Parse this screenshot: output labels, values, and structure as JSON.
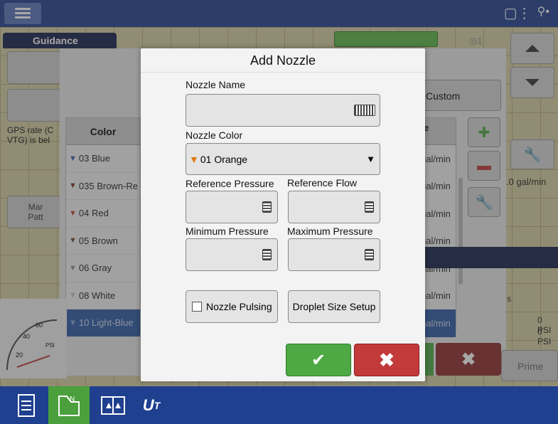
{
  "app": {
    "guidance_tab": "Guidance"
  },
  "back_panel": {
    "left_text": "GPS rate (C\nVTG) is bel",
    "left_btn_text": "Mar\nPatt",
    "gps_indicator": "◎1",
    "custom_button": "Custom",
    "color_header": "Color",
    "rate_header": "e",
    "colors": [
      {
        "label": "03 Blue",
        "color": "#2a5ea8"
      },
      {
        "label": "035 Brown-Re",
        "color": "#7a2a22"
      },
      {
        "label": "04 Red",
        "color": "#b8432a"
      },
      {
        "label": "05 Brown",
        "color": "#6d4a2e"
      },
      {
        "label": "06 Gray",
        "color": "#8a8a8a"
      },
      {
        "label": "08 White",
        "color": "#bdbdbd"
      },
      {
        "label": "10 Light-Blue",
        "color": "#8fa9d8"
      }
    ],
    "rates": [
      "gal/min",
      "gal/min",
      "gal/min",
      "gal/min",
      "gal/min",
      "gal/min",
      "gal/min"
    ],
    "side_text": ".0 gal/min",
    "psi_1": "0 PSI",
    "psi_2": "0 PSI",
    "prime": "Prime",
    "gauge_labels": [
      "60",
      "40",
      "20",
      "PSI"
    ],
    "section_mark": "s"
  },
  "modal": {
    "title": "Add Nozzle",
    "nozzle_name_label": "Nozzle Name",
    "nozzle_name_value": "",
    "nozzle_color_label": "Nozzle Color",
    "nozzle_color_value": "01 Orange",
    "nozzle_color_swatch": "#e07a12",
    "reference_pressure_label": "Reference Pressure",
    "reference_flow_label": "Reference Flow",
    "minimum_pressure_label": "Minimum Pressure",
    "maximum_pressure_label": "Maximum Pressure",
    "nozzle_pulsing_label": "Nozzle Pulsing",
    "droplet_size_label": "Droplet Size Setup",
    "ok_glyph": "✔",
    "cancel_glyph": "✖"
  },
  "colors": {
    "bar": "#1f3f8f",
    "accent_green": "#4ea944",
    "cancel_red": "#c23a3a"
  }
}
